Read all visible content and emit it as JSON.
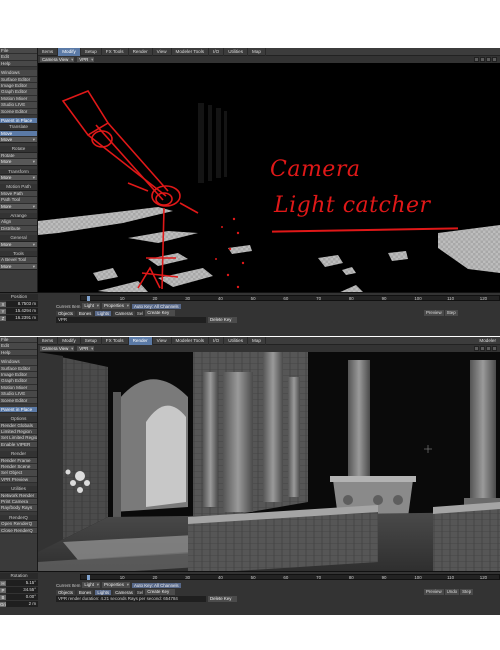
{
  "panels": [
    {
      "tabs": [
        "Items",
        "Modify",
        "Setup",
        "FX Tools",
        "Render",
        "View",
        "Modeler Tools",
        "I/O",
        "Utilities",
        "Map"
      ],
      "active_tab": 1,
      "top_right": "",
      "view_select": "Camera View",
      "view_mode": "VPR",
      "sidebar": [
        {
          "t": "File"
        },
        {
          "t": "Edit"
        },
        {
          "t": "Help"
        },
        {
          "t": "gap"
        },
        {
          "t": "Windows"
        },
        {
          "t": "Surface Editor"
        },
        {
          "t": "Image Editor"
        },
        {
          "t": "Graph Editor"
        },
        {
          "t": "Motion Mixer"
        },
        {
          "t": "Studio LIVE"
        },
        {
          "t": "Scene Editor"
        },
        {
          "t": "gap"
        },
        {
          "t": "Parent in Place",
          "active": true
        },
        {
          "t": "head",
          "label": "Translate"
        },
        {
          "t": "Move",
          "active": true
        },
        {
          "t": "drop",
          "label": "Move"
        },
        {
          "t": "gap"
        },
        {
          "t": "head",
          "label": "Rotate"
        },
        {
          "t": "Rotate"
        },
        {
          "t": "drop",
          "label": "More"
        },
        {
          "t": "gap"
        },
        {
          "t": "head",
          "label": "Transform"
        },
        {
          "t": "drop",
          "label": "More"
        },
        {
          "t": "gap"
        },
        {
          "t": "head",
          "label": "Motion Path"
        },
        {
          "t": "Move Path"
        },
        {
          "t": "Path Tool"
        },
        {
          "t": "drop",
          "label": "More"
        },
        {
          "t": "gap"
        },
        {
          "t": "head",
          "label": "Arrange"
        },
        {
          "t": "Align"
        },
        {
          "t": "Distribute"
        },
        {
          "t": "gap"
        },
        {
          "t": "head",
          "label": "General"
        },
        {
          "t": "drop",
          "label": "More"
        },
        {
          "t": "gap"
        },
        {
          "t": "head",
          "label": "Tools"
        },
        {
          "t": "A Bevel Tool"
        },
        {
          "t": "drop",
          "label": "More"
        }
      ],
      "bottom": {
        "label": "Position",
        "coords": [
          {
            "axis": "X",
            "value": "8.7503 m"
          },
          {
            "axis": "Y",
            "value": "15.4294 m"
          },
          {
            "axis": "Z",
            "value": "16.2391 m"
          }
        ],
        "timeline": [
          "0",
          "10",
          "20",
          "30",
          "40",
          "50",
          "60",
          "70",
          "80",
          "90",
          "100",
          "110",
          "120"
        ],
        "cursor_frame": 0,
        "current_item_label": "Current Item",
        "current_item": "Light",
        "properties": "Properties",
        "auto_key": "Auto Key: All Channels",
        "objects": "Objects",
        "bones": "Bones",
        "lights": "Lights",
        "cameras": "Cameras",
        "sel": "Sel",
        "create_key": "Create Key",
        "delete_key": "Delete Key",
        "status": "VPR",
        "preview": "Preview",
        "step": "Step"
      },
      "annotation": {
        "line1": "Camera",
        "line2": "Light catcher"
      }
    },
    {
      "tabs": [
        "Items",
        "Modify",
        "Setup",
        "FX Tools",
        "Render",
        "View",
        "Modeler Tools",
        "I/O",
        "Utilities",
        "Map"
      ],
      "active_tab": 4,
      "top_right": "Modeler",
      "view_select": "Camera View",
      "view_mode": "VPR",
      "sidebar": [
        {
          "t": "File"
        },
        {
          "t": "Edit"
        },
        {
          "t": "Help"
        },
        {
          "t": "gap"
        },
        {
          "t": "Windows"
        },
        {
          "t": "Surface Editor"
        },
        {
          "t": "Image Editor"
        },
        {
          "t": "Graph Editor"
        },
        {
          "t": "Motion Mixer"
        },
        {
          "t": "Studio LIVE"
        },
        {
          "t": "Scene Editor"
        },
        {
          "t": "gap"
        },
        {
          "t": "Parent in Place",
          "active": true
        },
        {
          "t": "gap"
        },
        {
          "t": "head",
          "label": "Options"
        },
        {
          "t": "Render Globals"
        },
        {
          "t": "Limited Region"
        },
        {
          "t": "Set Limited Region"
        },
        {
          "t": "Enable VIPER"
        },
        {
          "t": "gap"
        },
        {
          "t": "head",
          "label": "Render"
        },
        {
          "t": "Render Frame"
        },
        {
          "t": "Render Scene"
        },
        {
          "t": "Sel Object"
        },
        {
          "t": "VPR Preview"
        },
        {
          "t": "gap"
        },
        {
          "t": "head",
          "label": "Utilities"
        },
        {
          "t": "Network Render"
        },
        {
          "t": "Print Camera"
        },
        {
          "t": "Ray/body Rays"
        },
        {
          "t": "gap"
        },
        {
          "t": "head",
          "label": "RenderQ"
        },
        {
          "t": "Open RenderQ"
        },
        {
          "t": "Close RenderQ"
        }
      ],
      "bottom": {
        "label": "Rotation",
        "coords": [
          {
            "axis": "H",
            "value": "5.15°"
          },
          {
            "axis": "P",
            "value": "34.55°"
          },
          {
            "axis": "B",
            "value": "0.00°"
          }
        ],
        "grid_label": "Grid",
        "grid_value": "2 m",
        "timeline": [
          "0",
          "10",
          "20",
          "30",
          "40",
          "50",
          "60",
          "70",
          "80",
          "90",
          "100",
          "110",
          "120"
        ],
        "cursor_frame": 0,
        "current_item_label": "Current Item",
        "current_item": "Light",
        "properties": "Properties",
        "auto_key": "Auto Key: All Channels",
        "objects": "Objects",
        "bones": "Bones",
        "lights": "Lights",
        "cameras": "Cameras",
        "sel": "Sel",
        "create_key": "Create Key",
        "delete_key": "Delete Key",
        "status": "VPR render duration: 4.21 seconds  Rays per second: 654784",
        "preview": "Preview",
        "undo": "Undo",
        "step": "Step"
      }
    }
  ],
  "colors": {
    "annotation": "#e01818",
    "accent": "#5b7aa6",
    "ui_bg": "#2c2c2c"
  }
}
